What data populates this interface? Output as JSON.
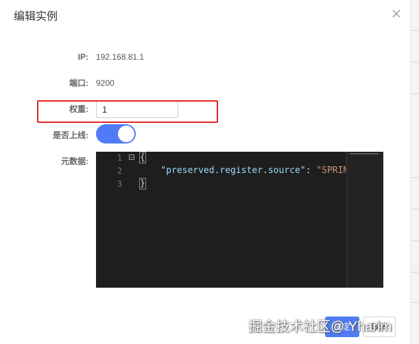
{
  "dialog": {
    "title": "编辑实例",
    "close_icon": "close-icon"
  },
  "form": {
    "ip_label": "IP:",
    "ip_value": "192.168.81.1",
    "port_label": "端口:",
    "port_value": "9200",
    "weight_label": "权重:",
    "weight_value": "1",
    "online_label": "是否上线:",
    "online_enabled": true,
    "metadata_label": "元数据:"
  },
  "editor": {
    "line_numbers": [
      "1",
      "2",
      "3"
    ],
    "line1": "{",
    "line2_key": "\"preserved.register.source\"",
    "line2_sep": ": ",
    "line2_value": "\"SPRING",
    "line3": "}"
  },
  "footer": {
    "ok_label": "确定",
    "cancel_label": "取消"
  },
  "watermark": "掘金技术社区@ Yharim",
  "colors": {
    "primary": "#4f7cf6",
    "highlight": "#e02424",
    "editor_bg": "#1e1e1e"
  }
}
